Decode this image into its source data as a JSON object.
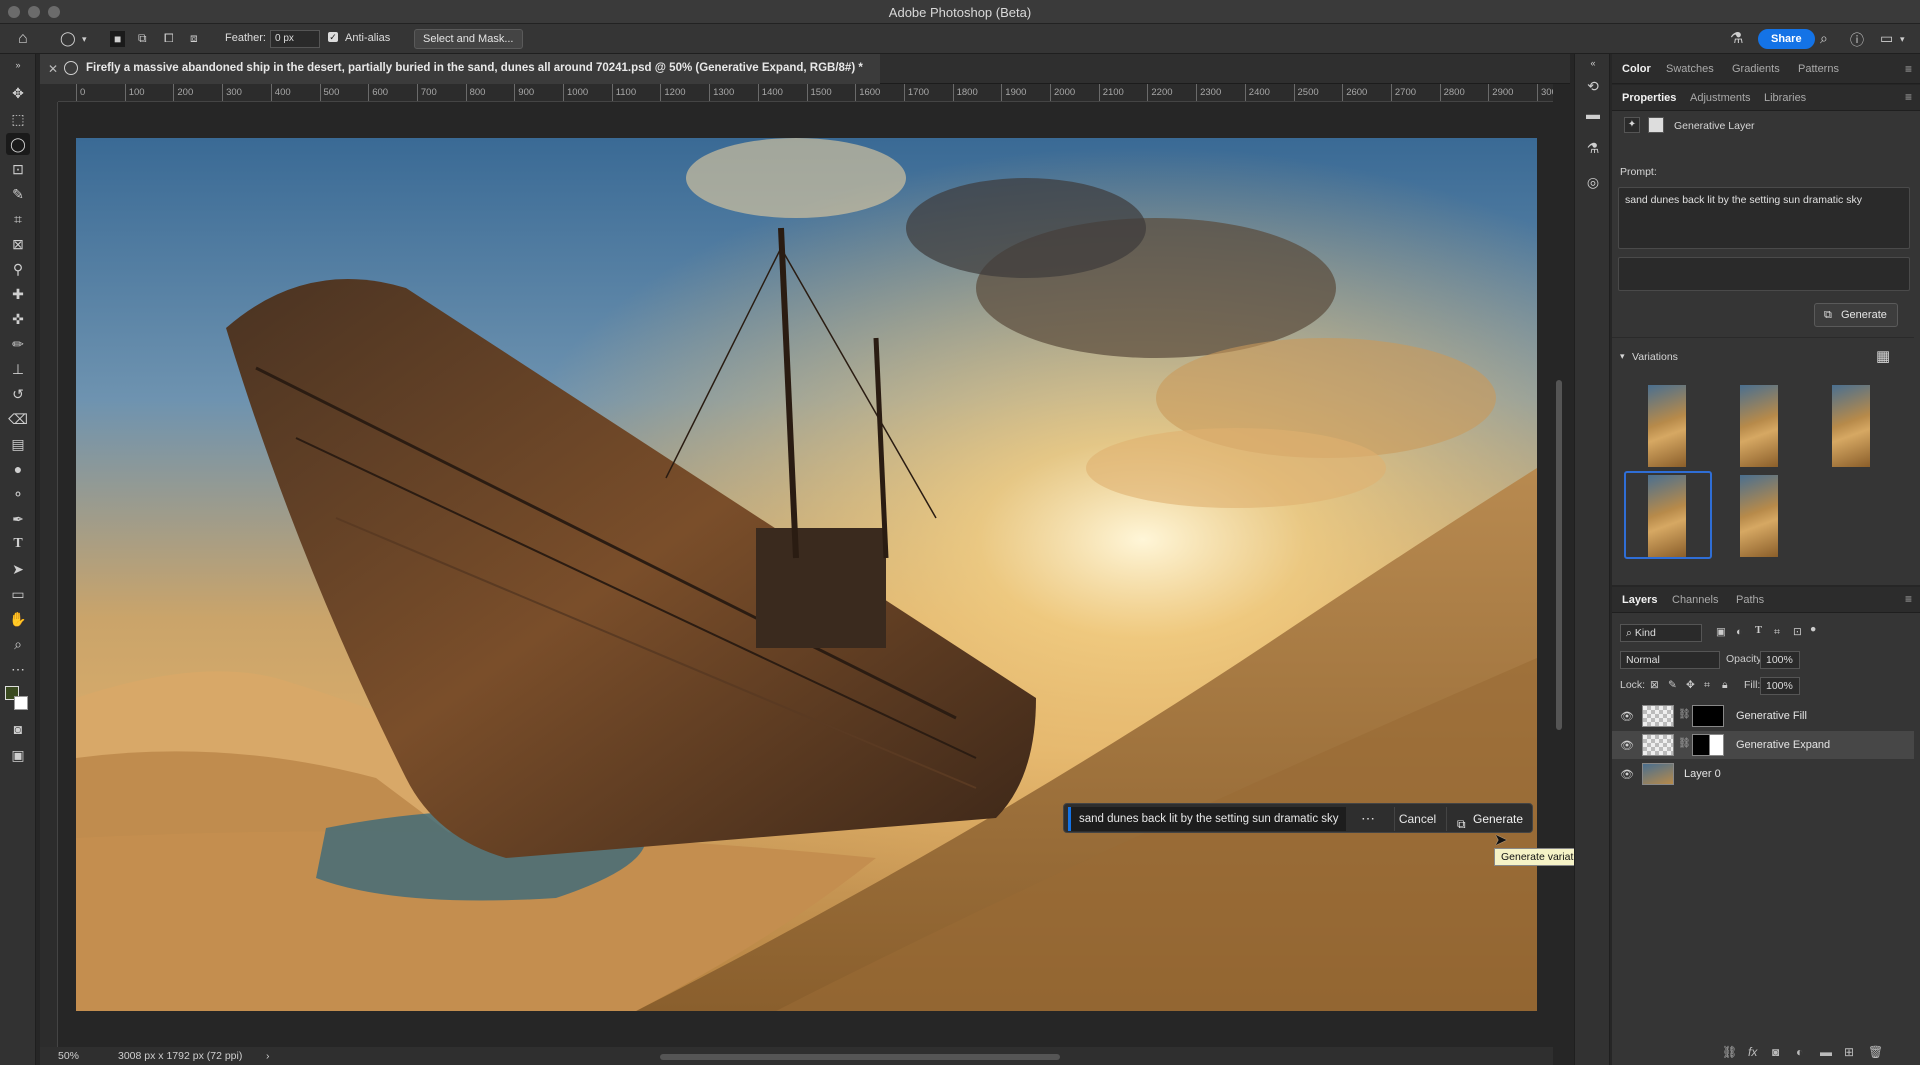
{
  "app": {
    "title": "Adobe Photoshop (Beta)"
  },
  "options": {
    "feather_label": "Feather:",
    "feather_value": "0 px",
    "antialias_label": "Anti-alias",
    "select_mask_label": "Select and Mask...",
    "share_label": "Share"
  },
  "document": {
    "tab_title": "Firefly a massive abandoned ship in the desert, partially buried in the sand, dunes all around 70241.psd @ 50% (Generative Expand, RGB/8#) *"
  },
  "ruler": {
    "h_labels": [
      "0",
      "100",
      "200",
      "300",
      "400",
      "500",
      "600",
      "700",
      "800",
      "900",
      "1000",
      "1100",
      "1200",
      "1300",
      "1400",
      "1500",
      "1600",
      "1700",
      "1800",
      "1900",
      "2000",
      "2100",
      "2200",
      "2300",
      "2400",
      "2500",
      "2600",
      "2700",
      "2800",
      "2900",
      "300"
    ]
  },
  "taskbar": {
    "prompt": "sand dunes back lit by the setting sun dramatic sky",
    "cancel_label": "Cancel",
    "generate_label": "Generate",
    "tooltip": "Generate variations"
  },
  "status": {
    "zoom": "50%",
    "doc_size": "3008 px x 1792 px (72 ppi)"
  },
  "panels": {
    "top_tabs": [
      "Color",
      "Swatches",
      "Gradients",
      "Patterns"
    ],
    "prop_tabs": [
      "Properties",
      "Adjustments",
      "Libraries"
    ],
    "layer_type": "Generative Layer",
    "prompt_label": "Prompt:",
    "prompt_text": "sand dunes back lit by the setting sun dramatic sky",
    "generate_label": "Generate",
    "variations_label": "Variations",
    "layers_tabs": [
      "Layers",
      "Channels",
      "Paths"
    ],
    "kind_label": "Kind",
    "blend_mode": "Normal",
    "opacity_label": "Opacity:",
    "opacity_value": "100%",
    "lock_label": "Lock:",
    "fill_label": "Fill:",
    "fill_value": "100%",
    "layers": [
      {
        "name": "Generative Fill"
      },
      {
        "name": "Generative Expand"
      },
      {
        "name": "Layer 0"
      }
    ]
  },
  "colors": {
    "accent": "#1473e6",
    "panel_bg": "#353535",
    "canvas_bg": "#262626"
  }
}
